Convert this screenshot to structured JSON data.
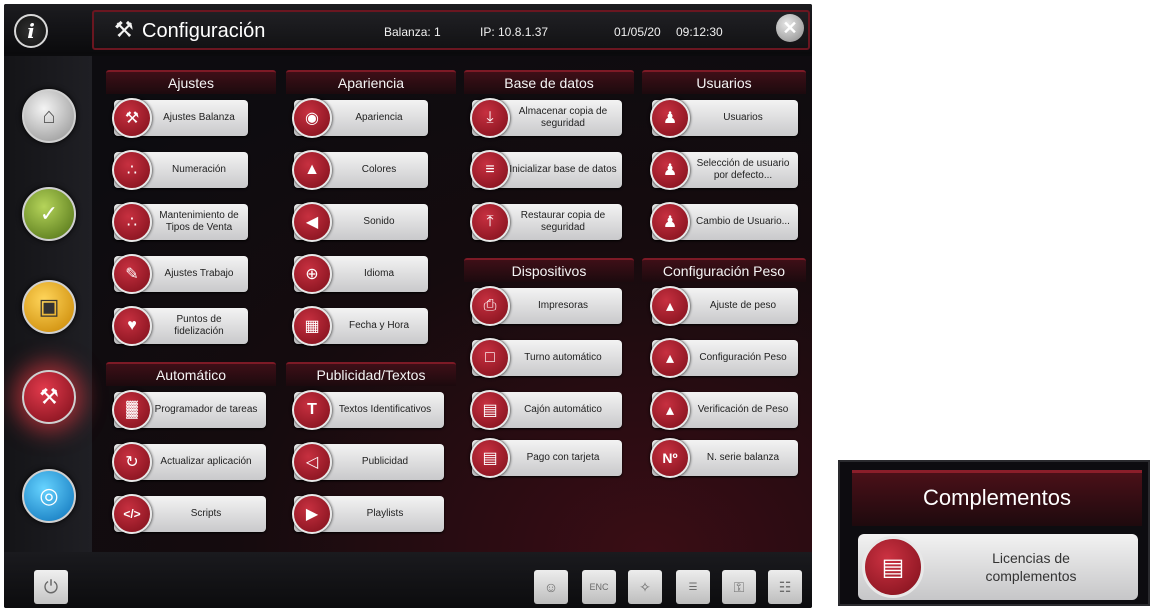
{
  "header": {
    "info_icon": "i",
    "title_icon": "tools-icon",
    "title": "Configuración",
    "balanza": "Balanza: 1",
    "ip": "IP: 10.8.1.37",
    "date": "01/05/20",
    "time": "09:12:30",
    "close_icon": "close-icon"
  },
  "rail": [
    {
      "name": "home",
      "icon": "home-icon"
    },
    {
      "name": "check",
      "icon": "check-icon"
    },
    {
      "name": "monitor",
      "icon": "monitor-icon"
    },
    {
      "name": "configuracion",
      "icon": "tools-icon",
      "active": true
    },
    {
      "name": "wifi",
      "icon": "wifi-icon"
    }
  ],
  "sections": {
    "ajustes": {
      "title": "Ajustes",
      "items": [
        "Ajustes Balanza",
        "Numeración",
        "Mantenimiento de\nTipos de Venta",
        "Ajustes Trabajo",
        "Puntos de fidelización"
      ]
    },
    "apariencia": {
      "title": "Apariencia",
      "items": [
        "Apariencia",
        "Colores",
        "Sonido",
        "Idioma",
        "Fecha y Hora"
      ]
    },
    "base_datos": {
      "title": "Base de datos",
      "items": [
        "Almacenar copia de\nseguridad",
        "Inicializar base de datos",
        "Restaurar copia de\nseguridad"
      ]
    },
    "usuarios": {
      "title": "Usuarios",
      "items": [
        "Usuarios",
        "Selección de usuario\npor defecto...",
        "Cambio de Usuario..."
      ]
    },
    "dispositivos": {
      "title": "Dispositivos",
      "items": [
        "Impresoras",
        "Turno automático",
        "Cajón automático",
        "Pago con tarjeta"
      ]
    },
    "config_peso": {
      "title": "Configuración Peso",
      "items": [
        "Ajuste de peso",
        "Configuración Peso",
        "Verificación de Peso",
        "N. serie balanza"
      ]
    },
    "automatico": {
      "title": "Automático",
      "items": [
        "Programador de tareas",
        "Actualizar aplicación",
        "Scripts"
      ]
    },
    "publicidad": {
      "title": "Publicidad/Textos",
      "items": [
        "Textos Identificativos",
        "Publicidad",
        "Playlists"
      ]
    }
  },
  "bottombar": {
    "power_icon": "power-icon",
    "buttons": [
      "user-icon",
      "enc-icon",
      "wand-icon",
      "code-list-icon",
      "key-icon",
      "document-icon"
    ],
    "enc_label": "ENC"
  },
  "inset": {
    "title": "Complementos",
    "button_label": "Licencias de\ncomplementos",
    "button_icon": "license-icon"
  },
  "colors": {
    "accent": "#b0202f",
    "arrow": "#e01818"
  }
}
